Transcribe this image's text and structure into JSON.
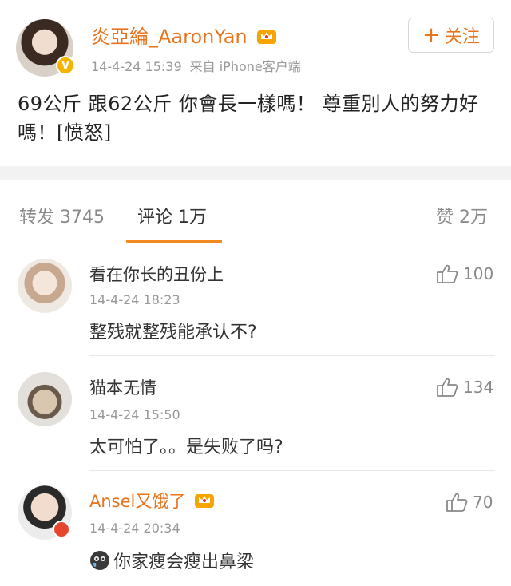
{
  "post": {
    "author": "炎亞綸_AaronYan",
    "timestamp": "14-4-24 15:39",
    "source": "来自 iPhone客户端",
    "follow_label": "关注",
    "text": "69公斤 跟62公斤 你會長一樣嗎！ 尊重別人的努力好嗎！[愤怒]",
    "verified_badge": "V"
  },
  "tabs": {
    "repost": "转发 3745",
    "comments": "评论 1万",
    "likes": "赞 2万"
  },
  "comments": [
    {
      "name": "看在你长的丑份上",
      "time": "14-4-24 18:23",
      "text": "整残就整残能承认不?",
      "likes": "100"
    },
    {
      "name": "猫本无情",
      "time": "14-4-24 15:50",
      "text": "太可怕了。。是失败了吗?",
      "likes": "134"
    },
    {
      "name": "Ansel又饿了",
      "time": "14-4-24 20:34",
      "text": "你家瘦会瘦出鼻梁",
      "likes": "70"
    }
  ],
  "colors": {
    "accent": "#e8741e",
    "tab_underline": "#f08a1e"
  },
  "icons": {
    "like": "thumbs-up-icon",
    "crown": "crown-icon",
    "follow": "plus-icon"
  }
}
